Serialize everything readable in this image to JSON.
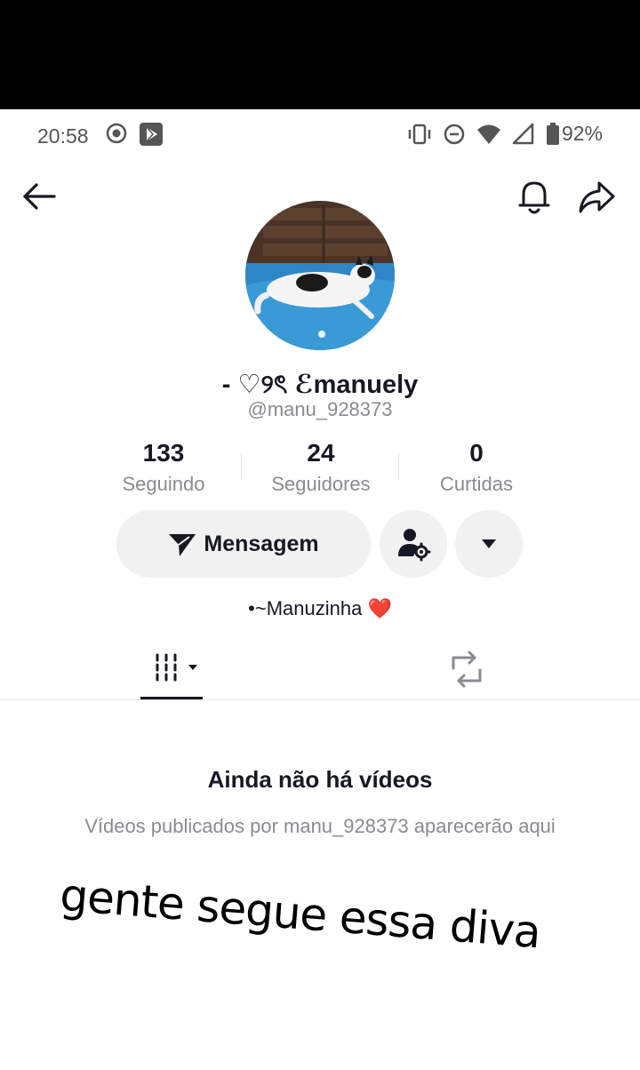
{
  "status_bar": {
    "time": "20:58",
    "battery": "92%",
    "icons": [
      "screen-record-icon",
      "play-store-icon",
      "vibrate-icon",
      "dnd-icon",
      "wifi-icon",
      "signal-icon",
      "battery-icon"
    ]
  },
  "nav": {
    "icons": [
      "back-arrow-icon",
      "bell-icon",
      "share-icon"
    ]
  },
  "profile": {
    "display_name": "- ♡୨ৎ ℰmanuely",
    "username": "@manu_928373",
    "bio": "•~Manuzinha ❤️"
  },
  "stats": [
    {
      "value": "133",
      "label": "Seguindo"
    },
    {
      "value": "24",
      "label": "Seguidores"
    },
    {
      "value": "0",
      "label": "Curtidas"
    }
  ],
  "actions": {
    "message_label": "Mensagem"
  },
  "empty_state": {
    "title": "Ainda não há vídeos",
    "description": "Vídeos publicados por manu_928373 aparecerão aqui"
  },
  "overlay": {
    "caption": "gente segue essa diva"
  },
  "colors": {
    "primary_text": "#161823",
    "secondary_text": "#8a8b91",
    "button_bg": "#f1f1f2",
    "heart": "#e53935"
  }
}
